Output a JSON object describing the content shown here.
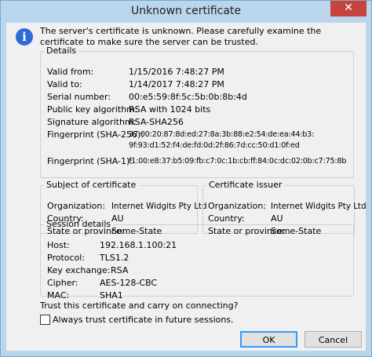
{
  "window": {
    "title": "Unknown certificate",
    "close_glyph": "✕"
  },
  "message": {
    "icon": "info-icon",
    "text": "The server's certificate is unknown. Please carefully examine the certificate to make sure the server can be trusted."
  },
  "details": {
    "legend": "Details",
    "valid_from": {
      "label": "Valid from:",
      "value": "1/15/2016 7:48:27 PM"
    },
    "valid_to": {
      "label": "Valid to:",
      "value": "1/14/2017 7:48:27 PM"
    },
    "serial": {
      "label": "Serial number:",
      "value": "00:e5:59:8f:5c:5b:0b:8b:4d"
    },
    "pubkey": {
      "label": "Public key algorithm:",
      "value": "RSA with 1024 bits"
    },
    "sigalg": {
      "label": "Signature algorithm:",
      "value": "RSA-SHA256"
    },
    "fp256": {
      "label": "Fingerprint (SHA-256):",
      "line1": "37:00:20:87:8d:ed:27:8a:3b:88:e2:54:de:ea:44:b3:",
      "line2": "9f:93:d1:52:f4:de:fd:0d:2f:86:7d:cc:50:d1:0f:ed"
    },
    "fp1": {
      "label": "Fingerprint (SHA-1):",
      "value": "f1:00:e8:37:b5:09:fb:c7:0c:1b:cb:ff:84:0c:dc:02:0b:c7:75:8b"
    }
  },
  "subject": {
    "legend": "Subject of certificate",
    "org": {
      "label": "Organization:",
      "value": "Internet Widgits Pty Ltd"
    },
    "country": {
      "label": "Country:",
      "value": "AU"
    },
    "state": {
      "label": "State or province:",
      "value": "Some-State"
    }
  },
  "issuer": {
    "legend": "Certificate issuer",
    "org": {
      "label": "Organization:",
      "value": "Internet Widgits Pty Ltd"
    },
    "country": {
      "label": "Country:",
      "value": "AU"
    },
    "state": {
      "label": "State or province:",
      "value": "Some-State"
    }
  },
  "session": {
    "legend": "Session details",
    "host": {
      "label": "Host:",
      "value": "192.168.1.100:21"
    },
    "protocol": {
      "label": "Protocol:",
      "value": "TLS1.2"
    },
    "kex": {
      "label": "Key exchange:",
      "value": "RSA"
    },
    "cipher": {
      "label": "Cipher:",
      "value": "AES-128-CBC"
    },
    "mac": {
      "label": "MAC:",
      "value": "SHA1"
    }
  },
  "trust": {
    "question": "Trust this certificate and carry on connecting?",
    "always_label": "Always trust certificate in future sessions.",
    "always_checked": false
  },
  "buttons": {
    "ok": "OK",
    "cancel": "Cancel"
  }
}
